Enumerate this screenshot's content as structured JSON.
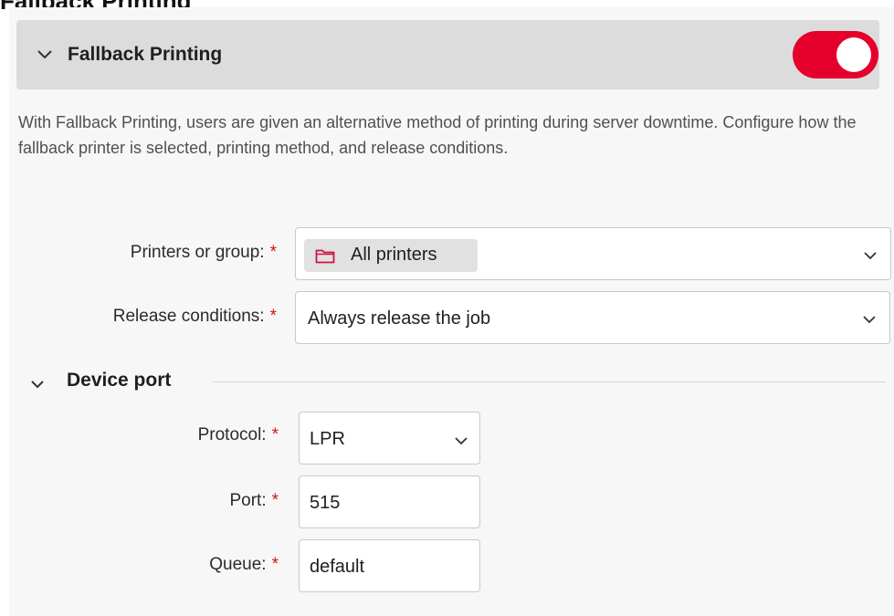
{
  "page_heading_partial": "Fallback Printing",
  "section": {
    "title": "Fallback Printing",
    "toggle_on": true,
    "toggle_color": "#e4002b",
    "description": "With Fallback Printing, users are given an alternative method of printing during server downtime. Configure how the fallback printer is selected, printing method, and release conditions."
  },
  "fields": {
    "printers": {
      "label": "Printers or group:",
      "required_mark": "*",
      "chip": "All printers",
      "chip_icon": "folder-icon"
    },
    "release": {
      "label": "Release conditions:",
      "required_mark": "*",
      "value": "Always release the job"
    }
  },
  "device_port": {
    "title": "Device port",
    "protocol": {
      "label": "Protocol:",
      "required_mark": "*",
      "value": "LPR"
    },
    "port": {
      "label": "Port:",
      "required_mark": "*",
      "value": "515"
    },
    "queue": {
      "label": "Queue:",
      "required_mark": "*",
      "value": "default"
    }
  }
}
